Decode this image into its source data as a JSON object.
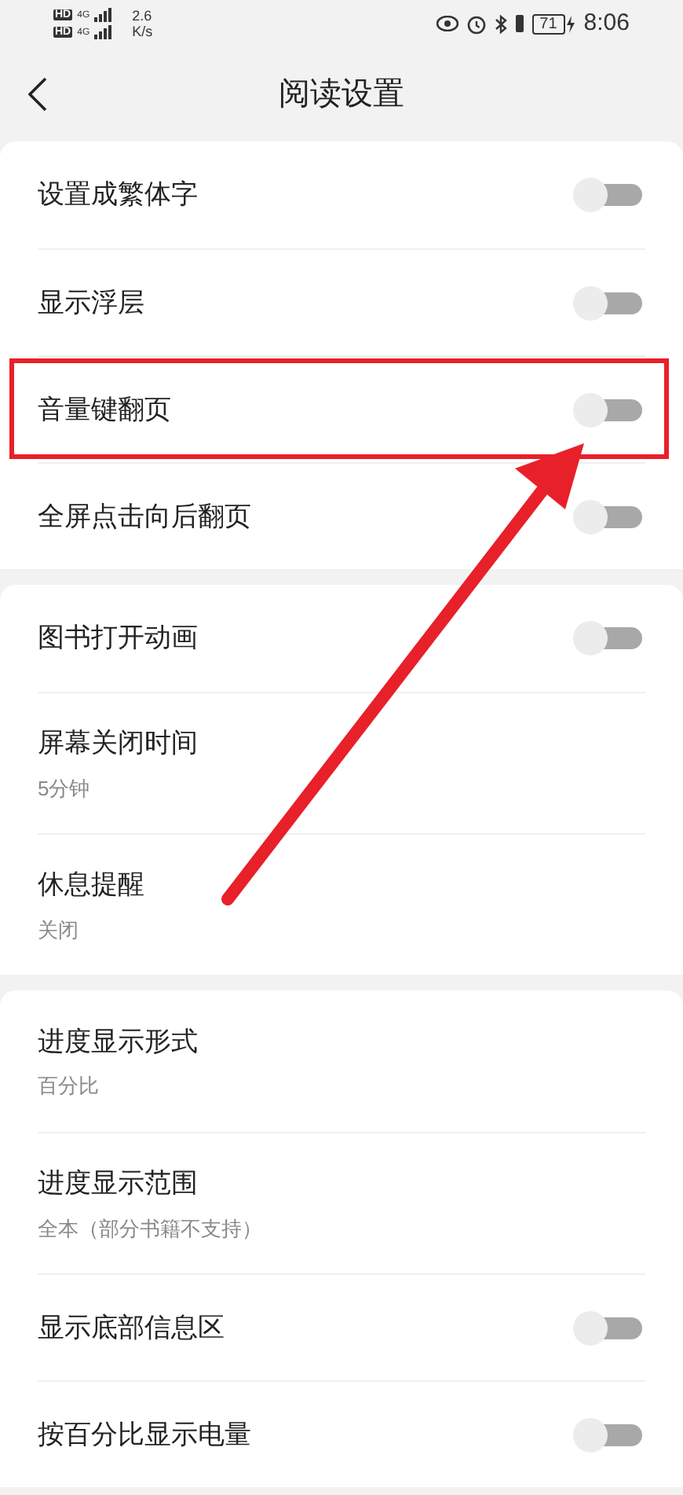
{
  "status_bar": {
    "sim_1": {
      "badge": "HD",
      "network": "4G"
    },
    "sim_2": {
      "badge": "HD",
      "network": "4G"
    },
    "speed": [
      "2.6",
      "K/s"
    ],
    "battery": "71",
    "time": "8:06"
  },
  "header": {
    "title": "阅读设置"
  },
  "groups": [
    {
      "items": [
        {
          "title": "设置成繁体字",
          "kind": "toggle",
          "on": false,
          "highlighted": false
        },
        {
          "title": "显示浮层",
          "kind": "toggle",
          "on": false,
          "highlighted": false
        },
        {
          "title": "音量键翻页",
          "kind": "toggle",
          "on": false,
          "highlighted": true
        },
        {
          "title": "全屏点击向后翻页",
          "kind": "toggle",
          "on": false,
          "highlighted": false
        }
      ]
    },
    {
      "items": [
        {
          "title": "图书打开动画",
          "kind": "toggle",
          "on": false,
          "highlighted": false
        },
        {
          "title": "屏幕关闭时间",
          "kind": "value",
          "subtitle": "5分钟",
          "highlighted": false
        },
        {
          "title": "休息提醒",
          "kind": "value",
          "subtitle": "关闭",
          "highlighted": false
        }
      ]
    },
    {
      "items": [
        {
          "title": "进度显示形式",
          "kind": "value",
          "subtitle": "百分比",
          "highlighted": false
        },
        {
          "title": "进度显示范围",
          "kind": "value",
          "subtitle": "全本（部分书籍不支持）",
          "highlighted": false
        },
        {
          "title": "显示底部信息区",
          "kind": "toggle",
          "on": false,
          "highlighted": false
        },
        {
          "title": "按百分比显示电量",
          "kind": "toggle",
          "on": false,
          "highlighted": false
        }
      ]
    }
  ]
}
